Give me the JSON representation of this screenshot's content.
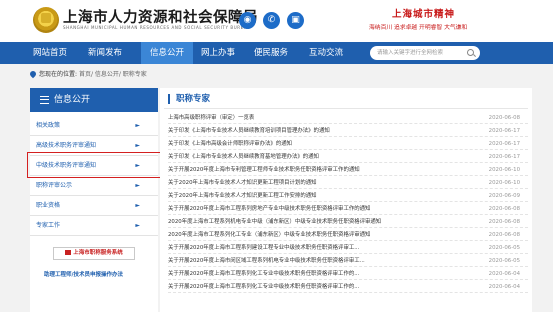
{
  "header": {
    "site_title": "上海市人力资源和社会保障局",
    "site_subtitle": "SHANGHAI MUNICIPAL HUMAN RESOURCES AND SOCIAL SECURITY BUREAU",
    "social_icons": [
      "weibo-icon",
      "wechat-icon",
      "app-icon"
    ],
    "slogan_title": "上海城市精神",
    "slogan_line": "海纳百川  追求卓越  开明睿智  大气谦和"
  },
  "nav": {
    "items": [
      "网站首页",
      "新闻发布",
      "信息公开",
      "网上办事",
      "便民服务",
      "互动交流"
    ],
    "active_index": 2,
    "search_placeholder": "请输入关键字进行全网检索"
  },
  "breadcrumb": {
    "label": "您现在的位置:",
    "path": "首页/ 信息公开/ 职称专家"
  },
  "sidebar": {
    "title": "信息公开",
    "items": [
      {
        "label": "相关政策"
      },
      {
        "label": "高级技术职务评审通知"
      },
      {
        "label": "中级技术职务评审通知"
      },
      {
        "label": "职称评审公示"
      },
      {
        "label": "职业资格"
      },
      {
        "label": "专家工作"
      }
    ],
    "arrow": "►",
    "highlighted_index": 2,
    "volunteer_button": "上海市职称服务系统",
    "guide_link": "助理工程师/技术员申报操作办法"
  },
  "main": {
    "title": "职称专家",
    "rows": [
      {
        "title": "上海市高级职称评审（审定）一览表",
        "date": "2020-06-08"
      },
      {
        "title": "关于印发《上海市专业技术人员继续教育培训项目管理办法》的通知",
        "date": "2020-06-17"
      },
      {
        "title": "关于印发《上海市高级会计师职称评审办法》的通知",
        "date": "2020-06-17"
      },
      {
        "title": "关于印发《上海市专业技术人员继续教育基地管理办法》的通知",
        "date": "2020-06-17"
      },
      {
        "title": "关于开展2020年度上海市专利管理工程师专业技术职务任职资格评审工作的通知",
        "date": "2020-06-10"
      },
      {
        "title": "关于2020年上海市专业技术人才知识更新工程项目计划的通知",
        "date": "2020-06-10"
      },
      {
        "title": "关于2020年上海市专业技术人才知识更新工程工作安排的通知",
        "date": "2020-06-09"
      },
      {
        "title": "关于开展2020年度上海市工程系列房地产专业中级技术职务任职资格评审工作的通知",
        "date": "2020-06-08"
      },
      {
        "title": "2020年度上海市工程系列机电专业中级（浦东新区）中级专业技术职务任职资格评审通知",
        "date": "2020-06-08"
      },
      {
        "title": "2020年度上海市工程系列化工专业（浦东新区）中级专业技术职务任职资格评审通知",
        "date": "2020-06-08"
      },
      {
        "title": "关于开展2020年度上海市工程系列建设工程专业中级技术职务任职资格评审工...",
        "date": "2020-06-05"
      },
      {
        "title": "关于开展2020年度上海市闵区域工程系列机电专业中级技术职务任职资格评审工...",
        "date": "2020-06-05"
      },
      {
        "title": "关于开展2020年度上海市工程系列化工专业中级技术职务任职资格评审工作的...",
        "date": "2020-06-04"
      },
      {
        "title": "关于开展2020年度上海市工程系列化工专业中级技术职务任职资格评审工作的...",
        "date": "2020-06-04"
      }
    ]
  }
}
